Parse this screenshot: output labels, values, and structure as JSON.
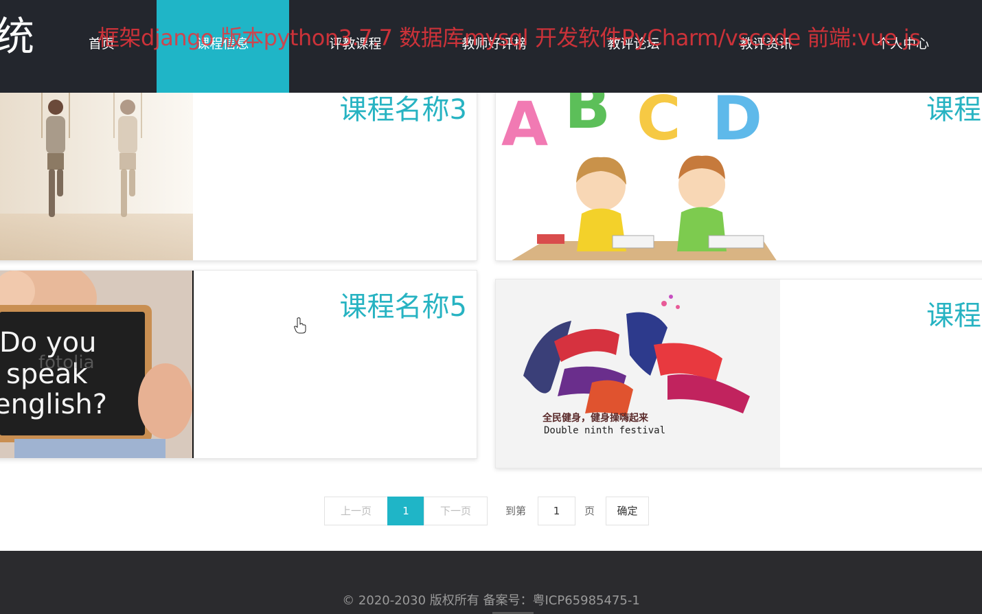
{
  "header": {
    "logo_text": "统",
    "watermark": "框架django 版本python3.7.7 数据库mysql 开发软件PyCharm/vscode 前端:vue.js",
    "nav": [
      {
        "label": "首页",
        "active": false
      },
      {
        "label": "课程信息",
        "active": true
      },
      {
        "label": "评教课程",
        "active": false
      },
      {
        "label": "教师好评榜",
        "active": false
      },
      {
        "label": "教评论坛",
        "active": false
      },
      {
        "label": "教评资讯",
        "active": false
      },
      {
        "label": "个人中心",
        "active": false
      }
    ]
  },
  "courses": [
    {
      "title": "课程名称3",
      "image": "yoga-class-photo"
    },
    {
      "title": "课程",
      "image": "abc-kids-illustration"
    },
    {
      "title": "课程名称5",
      "image": "do-you-speak-english-sign-photo",
      "sign_text": [
        "Do you",
        "speak",
        "english?"
      ],
      "sign_watermark": "fotolia"
    },
    {
      "title": "课程",
      "image": "fitness-calligraphy-poster",
      "poster_caption": "全民健身，健身操嗨起来",
      "poster_subcaption": "Double ninth festival"
    }
  ],
  "pagination": {
    "prev_label": "上一页",
    "current_page": "1",
    "next_label": "下一页",
    "goto_label": "到第",
    "goto_value": "1",
    "page_unit": "页",
    "confirm_label": "确定"
  },
  "footer": {
    "copyright": "© 2020-2030 版权所有 备案号：粤ICP65985475-1"
  },
  "colors": {
    "accent": "#1fb5c7",
    "title": "#27b3c2",
    "nav_bg": "#23262d",
    "footer_bg": "#2b2b2e",
    "watermark": "#e8343c"
  }
}
